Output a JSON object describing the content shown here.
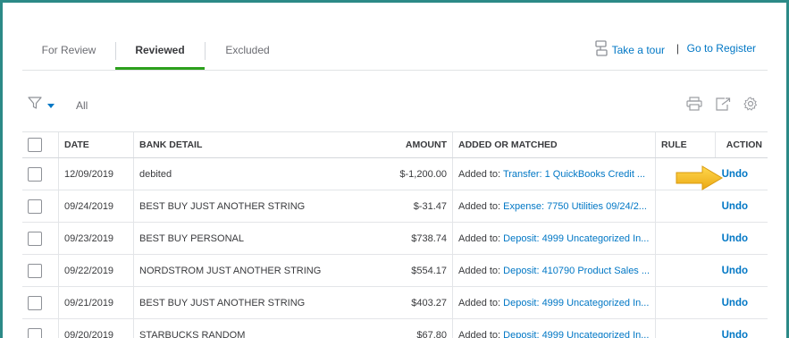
{
  "tabs": [
    {
      "label": "For Review",
      "active": false
    },
    {
      "label": "Reviewed",
      "active": true
    },
    {
      "label": "Excluded",
      "active": false
    }
  ],
  "header_links": {
    "take_tour": "Take a tour",
    "separator": "|",
    "go_register": "Go to Register"
  },
  "filter": {
    "label": "All"
  },
  "table": {
    "headers": {
      "date": "DATE",
      "bank_detail": "BANK DETAIL",
      "amount": "AMOUNT",
      "added_matched": "ADDED OR MATCHED",
      "rule": "RULE",
      "action": "ACTION"
    },
    "rows": [
      {
        "date": "12/09/2019",
        "detail": "debited",
        "amount": "$-1,200.00",
        "added_prefix": "Added to:",
        "added_link": "Transfer: 1 QuickBooks Credit ...",
        "rule": "",
        "action": "Undo"
      },
      {
        "date": "09/24/2019",
        "detail": "BEST BUY JUST ANOTHER STRING",
        "amount": "$-31.47",
        "added_prefix": "Added to:",
        "added_link": "Expense: 7750 Utilities 09/24/2...",
        "rule": "",
        "action": "Undo"
      },
      {
        "date": "09/23/2019",
        "detail": "BEST BUY PERSONAL",
        "amount": "$738.74",
        "added_prefix": "Added to:",
        "added_link": "Deposit: 4999 Uncategorized In...",
        "rule": "",
        "action": "Undo"
      },
      {
        "date": "09/22/2019",
        "detail": "NORDSTROM JUST ANOTHER STRING",
        "amount": "$554.17",
        "added_prefix": "Added to:",
        "added_link": "Deposit: 410790 Product Sales ...",
        "rule": "",
        "action": "Undo"
      },
      {
        "date": "09/21/2019",
        "detail": "BEST BUY JUST ANOTHER STRING",
        "amount": "$403.27",
        "added_prefix": "Added to:",
        "added_link": "Deposit: 4999 Uncategorized In...",
        "rule": "",
        "action": "Undo"
      },
      {
        "date": "09/20/2019",
        "detail": "STARBUCKS RANDOM",
        "amount": "$67.80",
        "added_prefix": "Added to:",
        "added_link": "Deposit: 4999 Uncategorized In...",
        "rule": "",
        "action": "Undo"
      }
    ]
  },
  "icons": {
    "tour": "tour-icon",
    "filter": "filter-icon",
    "print": "print-icon",
    "export": "export-icon",
    "settings": "gear-icon",
    "highlight": "arrow-pointer-icon"
  },
  "colors": {
    "frame": "#2c8a87",
    "link": "#0077c5",
    "active_tab": "#2ca01c",
    "arrow": "#f2b51e"
  }
}
